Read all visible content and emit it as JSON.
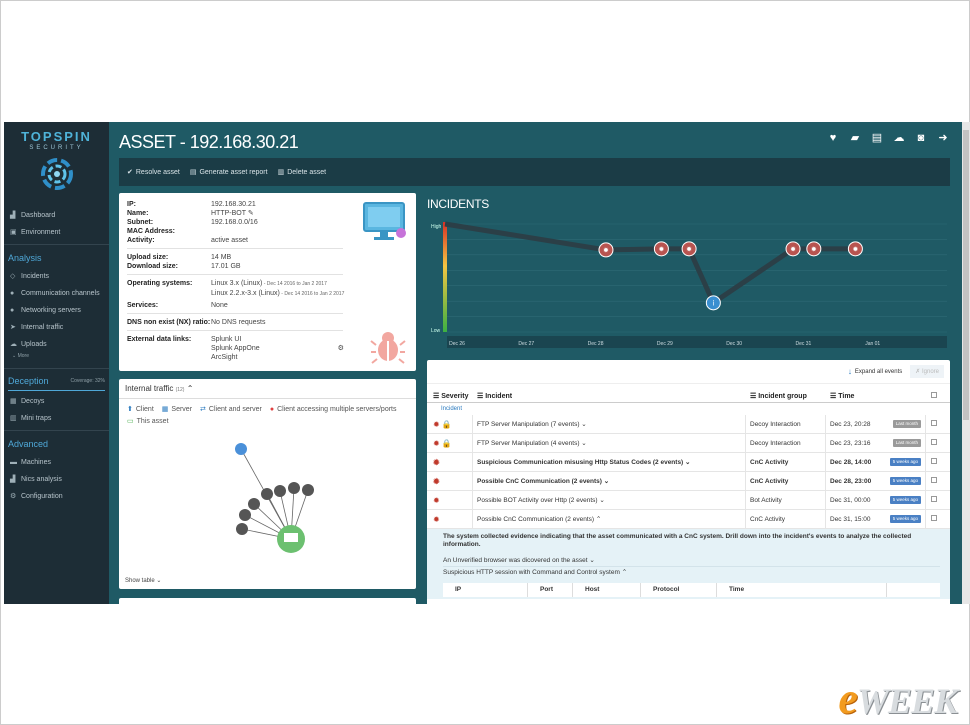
{
  "sidebar": {
    "logo_line1": "TOPSPIN",
    "logo_line2": "SECURITY",
    "top_items": [
      {
        "label": "Dashboard",
        "icon": "line-chart-icon"
      },
      {
        "label": "Environment",
        "icon": "image-icon"
      }
    ],
    "analysis_title": "Analysis",
    "analysis_items": [
      {
        "label": "Incidents",
        "icon": "diamond-icon"
      },
      {
        "label": "Communication channels",
        "icon": "chat-icon"
      },
      {
        "label": "Networking servers",
        "icon": "network-icon"
      },
      {
        "label": "Internal traffic",
        "icon": "arrow-icon"
      },
      {
        "label": "Uploads",
        "icon": "cloud-upload-icon"
      }
    ],
    "more_label": "More",
    "deception_title": "Deception",
    "coverage_label": "Coverage: 32%",
    "deception_items": [
      {
        "label": "Decoys",
        "icon": "decoy-icon"
      },
      {
        "label": "Mini traps",
        "icon": "trap-icon"
      }
    ],
    "advanced_title": "Advanced",
    "advanced_items": [
      {
        "label": "Machines",
        "icon": "machine-icon"
      },
      {
        "label": "Nics analysis",
        "icon": "chart-icon"
      },
      {
        "label": "Configuration",
        "icon": "gear-icon"
      }
    ]
  },
  "header": {
    "title": "ASSET - 192.168.30.21"
  },
  "toolbar": {
    "resolve": "Resolve asset",
    "report": "Generate asset report",
    "delete": "Delete asset"
  },
  "asset": {
    "ip_label": "IP:",
    "ip": "192.168.30.21",
    "name_label": "Name:",
    "name": "HTTP-BOT",
    "subnet_label": "Subnet:",
    "subnet": "192.168.0.0/16",
    "mac_label": "MAC Address:",
    "mac": "",
    "activity_label": "Activity:",
    "activity": "active asset",
    "upload_label": "Upload size:",
    "upload": "14 MB",
    "download_label": "Download size:",
    "download": "17.01 GB",
    "os_label": "Operating systems:",
    "os1": "Linux 3.x (Linux)",
    "os1_date": " - Dec 14 2016 to Jan 2 2017",
    "os2": "Linux 2.2.x-3.x (Linux)",
    "os2_date": " - Dec 14 2016 to Jan 2 2017",
    "services_label": "Services:",
    "services": "None",
    "dns_label": "DNS non exist (NX) ratio:",
    "dns": "No DNS requests",
    "ext_label": "External data links:",
    "ext": [
      "Splunk UI",
      "Splunk AppOne",
      "ArcSight"
    ]
  },
  "traffic": {
    "title": "Internal traffic",
    "count": "(12)",
    "legend": [
      "Client",
      "Server",
      "Client and server",
      "Client accessing multiple servers/ports",
      "This asset"
    ],
    "show_table": "Show table"
  },
  "incidents_chart": {
    "title": "INCIDENTS",
    "y_high": "High",
    "y_low": "Low",
    "x_ticks": [
      "Dec 26",
      "Dec 27",
      "Dec 28",
      "Dec 29",
      "Dec 30",
      "Dec 31",
      "Jan 01"
    ]
  },
  "chart_data": {
    "type": "line",
    "title": "INCIDENTS",
    "xlabel": "",
    "ylabel": "",
    "x": [
      "Dec 26",
      "Dec 27",
      "Dec 28",
      "Dec 29",
      "Dec 30",
      "Dec 31",
      "Jan 01"
    ],
    "y_scale": [
      "Low",
      "High"
    ],
    "points": [
      {
        "x": 2.65,
        "y": 0.76,
        "kind": "bug"
      },
      {
        "x": 3.45,
        "y": 0.77,
        "kind": "bug"
      },
      {
        "x": 3.85,
        "y": 0.77,
        "kind": "bug"
      },
      {
        "x": 4.2,
        "y": 0.27,
        "kind": "info"
      },
      {
        "x": 5.35,
        "y": 0.77,
        "kind": "bug"
      },
      {
        "x": 5.65,
        "y": 0.77,
        "kind": "bug"
      },
      {
        "x": 6.25,
        "y": 0.77,
        "kind": "bug"
      }
    ]
  },
  "incidents": {
    "expand_all": "Expand all events",
    "ignore": "Ignore",
    "col_severity": "Severity",
    "col_incident": "Incident",
    "col_group": "Incident group",
    "col_time": "Time",
    "tab": "Incident",
    "rows": [
      {
        "incident": "FTP Server Manipulation (7 events)",
        "group": "Decoy Interaction",
        "time": "Dec 23, 20:28",
        "badge": "Last month",
        "badge_color": "grey",
        "bold": false,
        "lock": true
      },
      {
        "incident": "FTP Server Manipulation (4 events)",
        "group": "Decoy Interaction",
        "time": "Dec 23, 23:16",
        "badge": "Last month",
        "badge_color": "grey",
        "bold": false,
        "lock": true
      },
      {
        "incident": "Suspicious Communication misusing Http Status Codes (2 events)",
        "group": "CnC Activity",
        "time": "Dec 28, 14:00",
        "badge": "5 weeks ago",
        "badge_color": "blue",
        "bold": true,
        "lock": false
      },
      {
        "incident": "Possible CnC Communication (2 events)",
        "group": "CnC Activity",
        "time": "Dec 28, 23:00",
        "badge": "5 weeks ago",
        "badge_color": "blue",
        "bold": true,
        "lock": false
      },
      {
        "incident": "Possible BOT Activity over Http (2 events)",
        "group": "Bot Activity",
        "time": "Dec 31, 00:00",
        "badge": "5 weeks ago",
        "badge_color": "blue",
        "bold": false,
        "lock": false
      },
      {
        "incident": "Possible CnC Communication (2 events)",
        "group": "CnC Activity",
        "time": "Dec 31, 15:00",
        "badge": "5 weeks ago",
        "badge_color": "blue",
        "bold": false,
        "lock": false
      }
    ],
    "expanded_desc": "The system collected evidence indicating that the asset communicated with a CnC system. Drill down into the incident's events to analyze the collected information.",
    "expanded_sub1": "An Unverified browser was dicovered on the asset",
    "expanded_sub2": "Suspicious HTTP session with Command and Control system",
    "sub_cols": [
      "IP",
      "Port",
      "Host",
      "Protocol",
      "Time"
    ]
  },
  "watermark": {
    "text_e": "e",
    "text_rest": "WEEK"
  },
  "colors": {
    "app_bg": "#1f5a65",
    "sidebar_bg": "#1d2d36",
    "accent": "#4fa8d8",
    "severity_red": "#c0392b",
    "badge_blue": "#4a80c4"
  }
}
